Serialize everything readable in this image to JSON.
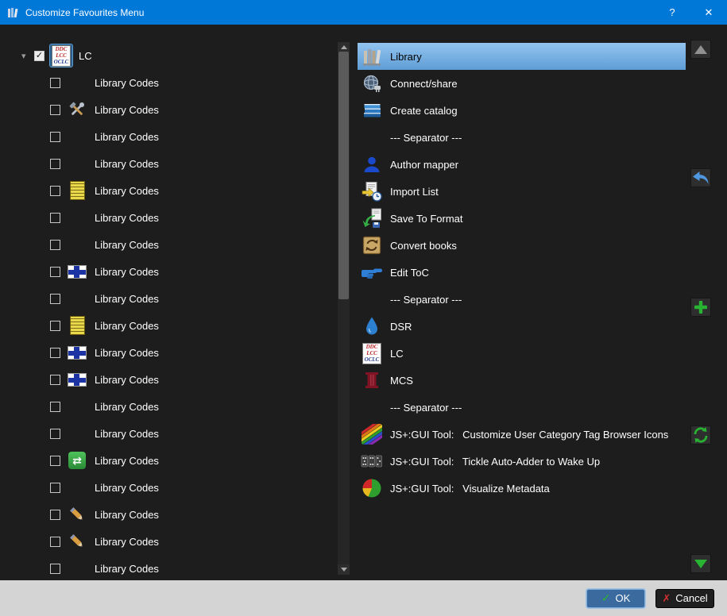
{
  "window": {
    "title": "Customize Favourites Menu",
    "icon": "books-stack",
    "help_label": "?",
    "close_label": "✕"
  },
  "tree": {
    "items": [
      {
        "label": "LC",
        "level": 0,
        "expanded": true,
        "checked": true,
        "icon": "lc-badge",
        "focused": true
      },
      {
        "label": "Library Codes",
        "level": 1,
        "checked": false,
        "icon": null
      },
      {
        "label": "Library Codes",
        "level": 1,
        "checked": false,
        "icon": "tools"
      },
      {
        "label": "Library Codes",
        "level": 1,
        "checked": false,
        "icon": null
      },
      {
        "label": "Library Codes",
        "level": 1,
        "checked": false,
        "icon": null
      },
      {
        "label": "Library Codes",
        "level": 1,
        "checked": false,
        "icon": "yellow-tag"
      },
      {
        "label": "Library Codes",
        "level": 1,
        "checked": false,
        "icon": null
      },
      {
        "label": "Library Codes",
        "level": 1,
        "checked": false,
        "icon": null
      },
      {
        "label": "Library Codes",
        "level": 1,
        "checked": false,
        "icon": "finnish-flag"
      },
      {
        "label": "Library Codes",
        "level": 1,
        "checked": false,
        "icon": null
      },
      {
        "label": "Library Codes",
        "level": 1,
        "checked": false,
        "icon": "yellow-tag"
      },
      {
        "label": "Library Codes",
        "level": 1,
        "checked": false,
        "icon": "finnish-flag"
      },
      {
        "label": "Library Codes",
        "level": 1,
        "checked": false,
        "icon": "finnish-flag"
      },
      {
        "label": "Library Codes",
        "level": 1,
        "checked": false,
        "icon": null
      },
      {
        "label": "Library Codes",
        "level": 1,
        "checked": false,
        "icon": null
      },
      {
        "label": "Library Codes",
        "level": 1,
        "checked": false,
        "icon": "green-swap"
      },
      {
        "label": "Library Codes",
        "level": 1,
        "checked": false,
        "icon": null
      },
      {
        "label": "Library Codes",
        "level": 1,
        "checked": false,
        "icon": "pencil"
      },
      {
        "label": "Library Codes",
        "level": 1,
        "checked": false,
        "icon": "pencil"
      },
      {
        "label": "Library Codes",
        "level": 1,
        "checked": false,
        "icon": null
      }
    ]
  },
  "menu": {
    "items": [
      {
        "label": "Library",
        "icon": "library",
        "selected": true,
        "separator": false
      },
      {
        "label": "Connect/share",
        "icon": "connect-share",
        "selected": false,
        "separator": false
      },
      {
        "label": "Create catalog",
        "icon": "create-catalog",
        "selected": false,
        "separator": false
      },
      {
        "label": "--- Separator ---",
        "icon": null,
        "selected": false,
        "separator": true
      },
      {
        "label": "Author mapper",
        "icon": "author-mapper",
        "selected": false,
        "separator": false
      },
      {
        "label": "Import List",
        "icon": "import-list",
        "selected": false,
        "separator": false
      },
      {
        "label": "Save To Format",
        "icon": "save-to-format",
        "selected": false,
        "separator": false
      },
      {
        "label": "Convert books",
        "icon": "convert-books",
        "selected": false,
        "separator": false
      },
      {
        "label": "Edit ToC",
        "icon": "edit-toc",
        "selected": false,
        "separator": false
      },
      {
        "label": "--- Separator ---",
        "icon": null,
        "selected": false,
        "separator": true
      },
      {
        "label": "DSR",
        "icon": "dsr-drop",
        "selected": false,
        "separator": false
      },
      {
        "label": "LC",
        "icon": "lc-badge",
        "selected": false,
        "separator": false
      },
      {
        "label": "MCS",
        "icon": "mcs",
        "selected": false,
        "separator": false
      },
      {
        "label": "--- Separator ---",
        "icon": null,
        "selected": false,
        "separator": true
      },
      {
        "label": "JS+:GUI Tool:   Customize User Category Tag Browser Icons",
        "icon": "tag-browser-icons",
        "selected": false,
        "separator": false
      },
      {
        "label": "JS+:GUI Tool:   Tickle Auto-Adder to Wake Up",
        "icon": "auto-adder",
        "selected": false,
        "separator": false
      },
      {
        "label": "JS+:GUI Tool:   Visualize Metadata",
        "icon": "pie-chart",
        "selected": false,
        "separator": false
      }
    ]
  },
  "side_buttons": [
    {
      "name": "move-up",
      "icon": "arrow-up"
    },
    {
      "name": "restore",
      "icon": "undo-arrow"
    },
    {
      "name": "add",
      "icon": "plus"
    },
    {
      "name": "replace",
      "icon": "swap-refresh"
    },
    {
      "name": "move-down",
      "icon": "arrow-down"
    }
  ],
  "footer": {
    "ok_label": "OK",
    "ok_icon": "check",
    "cancel_label": "Cancel",
    "cancel_icon": "cross"
  },
  "colors": {
    "titlebar": "#0078d7",
    "selection": "#6fa8dc",
    "background": "#1d1d1d",
    "footer_bg": "#d4d4d4"
  }
}
